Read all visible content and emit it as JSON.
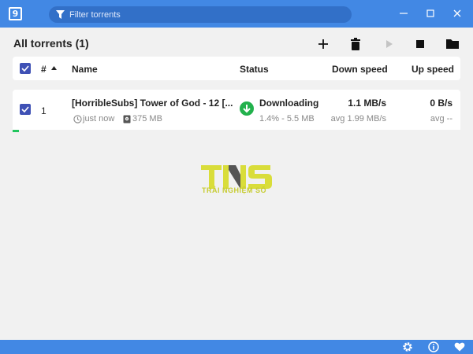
{
  "titlebar": {
    "search_placeholder": "Filter torrents",
    "accent": "#4288e4",
    "app_icon_glyph": "9"
  },
  "header": {
    "title": "All torrents (1)",
    "tools": [
      "add-icon",
      "trash-icon",
      "play-icon",
      "stop-icon",
      "folder-icon"
    ]
  },
  "columns": {
    "number": "#",
    "name": "Name",
    "status": "Status",
    "down_speed": "Down speed",
    "up_speed": "Up speed"
  },
  "torrents": [
    {
      "index": "1",
      "name": "[HorribleSubs] Tower of God - 12 [...",
      "added": "just now",
      "size": "375 MB",
      "status": "Downloading",
      "progress_text": "1.4% - 5.5 MB",
      "progress_fraction": 0.014,
      "down_speed": "1.1 MB/s",
      "down_avg": "avg 1.99 MB/s",
      "up_speed": "0 B/s",
      "up_avg": "avg --",
      "status_color": "#22b14c"
    }
  ],
  "watermark": {
    "subtitle": "TRẢI NGHIỆM SỐ"
  },
  "bottombar": {
    "icons": [
      "settings-icon",
      "info-icon",
      "heart-icon"
    ]
  }
}
